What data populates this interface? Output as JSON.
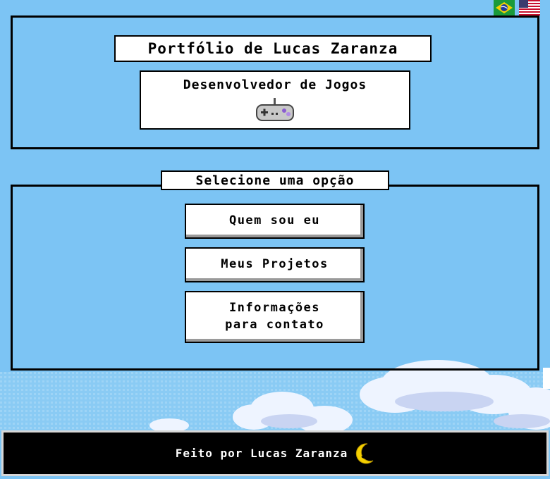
{
  "header": {
    "title": "Portfólio de Lucas Zaranza",
    "subtitle": "Desenvolvedor de Jogos",
    "subtitle_icon": "gamepad-icon"
  },
  "languages": [
    {
      "name": "Português",
      "icon": "brazil-flag-icon"
    },
    {
      "name": "English",
      "icon": "usa-flag-icon"
    }
  ],
  "menu": {
    "legend": "Selecione uma opção",
    "buttons": [
      {
        "label": "Quem sou eu"
      },
      {
        "label": "Meus Projetos"
      },
      {
        "label_line1": "Informações",
        "label_line2": "para contato"
      }
    ]
  },
  "footer": {
    "text": "Feito por Lucas Zaranza",
    "icon": "moon-icon"
  },
  "colors": {
    "sky": "#7cc4f4",
    "border": "#000000",
    "panel_fill": "#ffffff",
    "footer_bg": "#000000",
    "moon": "#f5d000"
  }
}
